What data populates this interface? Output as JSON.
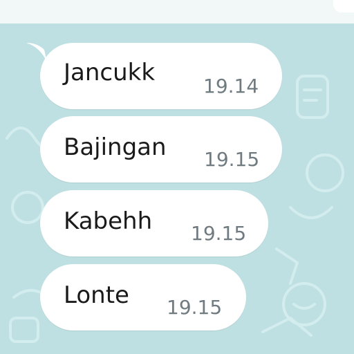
{
  "chat": {
    "background_color": "#bfe0e2",
    "bubble_color": "#ffffff",
    "messages": [
      {
        "text": "Jancukk",
        "time": "19.14"
      },
      {
        "text": "Bajingan",
        "time": "19.15"
      },
      {
        "text": "Kabehh",
        "time": "19.15"
      },
      {
        "text": "Lonte",
        "time": "19.15"
      }
    ]
  }
}
